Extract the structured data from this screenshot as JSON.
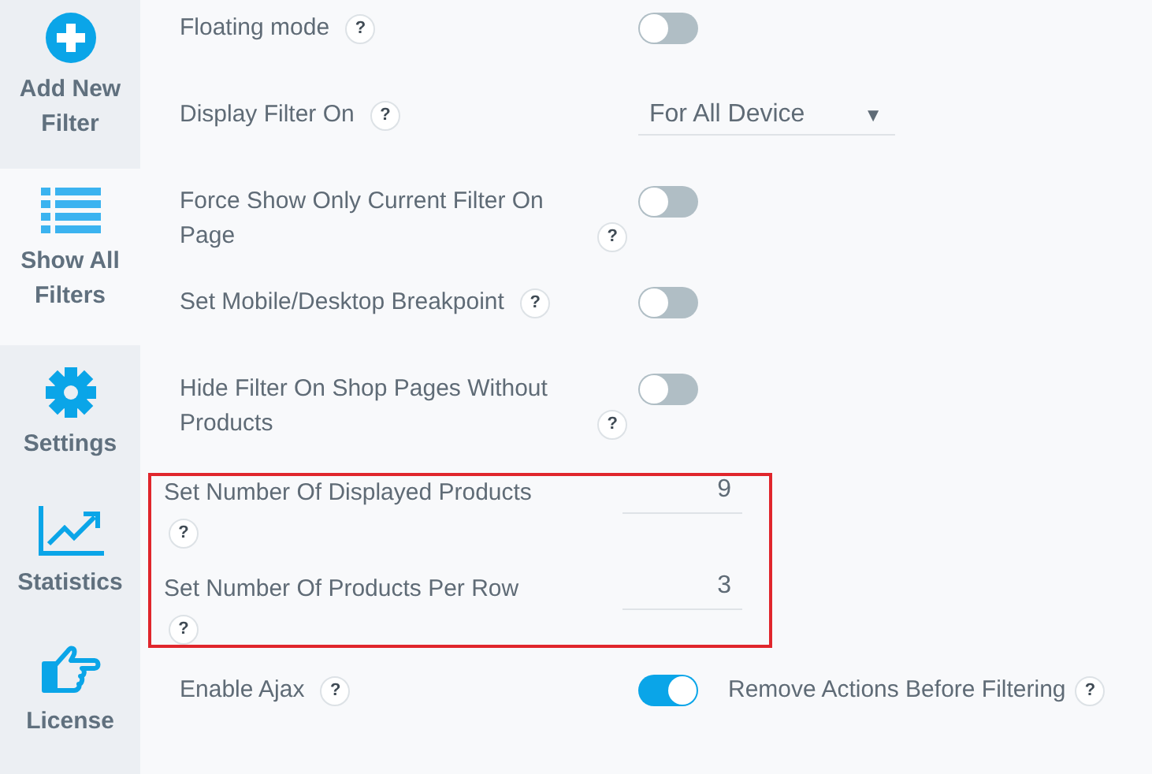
{
  "sidebar": {
    "items": [
      {
        "kind": "add",
        "label": "Add New Filter",
        "selected": false
      },
      {
        "kind": "list",
        "label": "Show All Filters",
        "selected": true
      },
      {
        "kind": "gear",
        "label": "Settings",
        "selected": false
      },
      {
        "kind": "chart",
        "label": "Statistics",
        "selected": false
      },
      {
        "kind": "hand",
        "label": "License",
        "selected": false
      }
    ]
  },
  "settings": [
    {
      "kind": "toggle",
      "label": "Floating mode",
      "help": "?",
      "on": false
    },
    {
      "kind": "select",
      "label": "Display Filter On",
      "help": "?",
      "value": "For All Device",
      "caret": "▼"
    },
    {
      "kind": "toggle",
      "label": "Force Show Only Current Filter On Page",
      "help": "?",
      "on": false
    },
    {
      "kind": "toggle",
      "label": "Set Mobile/Desktop Breakpoint",
      "help": "?",
      "on": false
    },
    {
      "kind": "toggle",
      "label": "Hide Filter On Shop Pages Without Products",
      "help": "?",
      "on": false
    },
    {
      "kind": "group",
      "highlighted": true,
      "rows": [
        {
          "kind": "number",
          "label": "Set Number Of Displayed Products",
          "help": "?",
          "value": "9"
        },
        {
          "kind": "number",
          "label": "Set Number Of Products Per Row",
          "help": "?",
          "value": "3"
        }
      ]
    },
    {
      "kind": "toggle",
      "label": "Enable Ajax",
      "help": "?",
      "on": true,
      "extra": {
        "label": "Remove Actions Before Filtering",
        "help": "?"
      }
    }
  ]
}
